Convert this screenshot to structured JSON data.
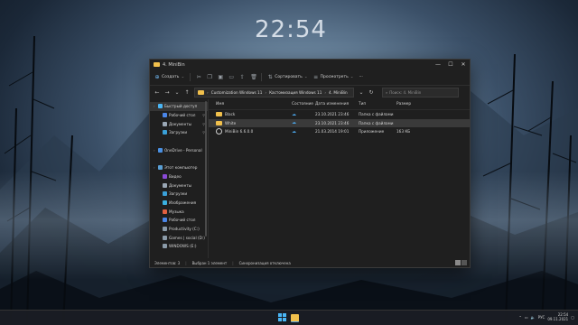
{
  "desktop": {
    "clock": "22:54"
  },
  "window": {
    "title": "4. MiniBin",
    "controls": {
      "minimize": "—",
      "maximize": "☐",
      "close": "✕"
    }
  },
  "toolbar": {
    "new_label": "Создать",
    "sort_label": "Сортировать",
    "view_label": "Просмотреть",
    "more_label": "···"
  },
  "address": {
    "crumbs": [
      "Customization Windows 11",
      "Кастомизация Windows 11",
      "4. MiniBin"
    ],
    "search_placeholder": "Поиск: 4. MiniBin"
  },
  "nav": {
    "items": [
      {
        "label": "Быстрый доступ",
        "icon": "star-icon",
        "color": "#4ab6f5",
        "level": 0,
        "selected": true,
        "pinned": false
      },
      {
        "label": "Рабочий стол",
        "icon": "desktop-icon",
        "color": "#4a86e8",
        "level": 1,
        "selected": false,
        "pinned": true
      },
      {
        "label": "Документы",
        "icon": "documents-icon",
        "color": "#9aa7b5",
        "level": 1,
        "selected": false,
        "pinned": true
      },
      {
        "label": "Загрузки",
        "icon": "downloads-icon",
        "color": "#3aa0d8",
        "level": 1,
        "selected": false,
        "pinned": true
      },
      {
        "label": "",
        "icon": "",
        "color": "",
        "level": 0,
        "selected": false,
        "pinned": false
      },
      {
        "label": "OneDrive - Personal",
        "icon": "cloud-icon",
        "color": "#4a90e2",
        "level": 0,
        "selected": false,
        "pinned": false
      },
      {
        "label": "",
        "icon": "",
        "color": "",
        "level": 0,
        "selected": false,
        "pinned": false
      },
      {
        "label": "Этот компьютер",
        "icon": "computer-icon",
        "color": "#5a9fd4",
        "level": 0,
        "selected": false,
        "pinned": false
      },
      {
        "label": "Видео",
        "icon": "video-icon",
        "color": "#8a4ad8",
        "level": 1,
        "selected": false,
        "pinned": false
      },
      {
        "label": "Документы",
        "icon": "documents-icon",
        "color": "#9aa7b5",
        "level": 1,
        "selected": false,
        "pinned": false
      },
      {
        "label": "Загрузки",
        "icon": "downloads-icon",
        "color": "#3aa0d8",
        "level": 1,
        "selected": false,
        "pinned": false
      },
      {
        "label": "Изображения",
        "icon": "pictures-icon",
        "color": "#3ab0e0",
        "level": 1,
        "selected": false,
        "pinned": false
      },
      {
        "label": "Музыка",
        "icon": "music-icon",
        "color": "#e06040",
        "level": 1,
        "selected": false,
        "pinned": false
      },
      {
        "label": "Рабочий стол",
        "icon": "desktop-icon",
        "color": "#4a86e8",
        "level": 1,
        "selected": false,
        "pinned": false
      },
      {
        "label": "Productivity (C:)",
        "icon": "drive-icon",
        "color": "#8a9aa8",
        "level": 1,
        "selected": false,
        "pinned": false
      },
      {
        "label": "Games | social (D:)",
        "icon": "drive-icon",
        "color": "#8a9aa8",
        "level": 1,
        "selected": false,
        "pinned": false
      },
      {
        "label": "WINDOWS (E:)",
        "icon": "drive-icon",
        "color": "#8a9aa8",
        "level": 1,
        "selected": false,
        "pinned": false
      }
    ]
  },
  "files": {
    "headers": {
      "name": "Имя",
      "status": "Состояние",
      "date": "Дата изменения",
      "type": "Тип",
      "size": "Размер"
    },
    "rows": [
      {
        "name": "Black",
        "kind": "folder",
        "date": "23.10.2021 23:46",
        "type": "Папка с файлами",
        "size": "",
        "selected": false
      },
      {
        "name": "White",
        "kind": "folder",
        "date": "23.10.2021 23:46",
        "type": "Папка с файлами",
        "size": "",
        "selected": true
      },
      {
        "name": "MiniBin 6.6.0.0",
        "kind": "app",
        "date": "21.03.2014 19:01",
        "type": "Приложение",
        "size": "163 КБ",
        "selected": false
      }
    ]
  },
  "statusbar": {
    "items": "Элементов: 3",
    "selected": "Выбран 1 элемент",
    "sync": "Синхронизация отключена"
  },
  "taskbar": {
    "lang": "РУС",
    "time": "22:54",
    "date": "09.11.2021"
  }
}
